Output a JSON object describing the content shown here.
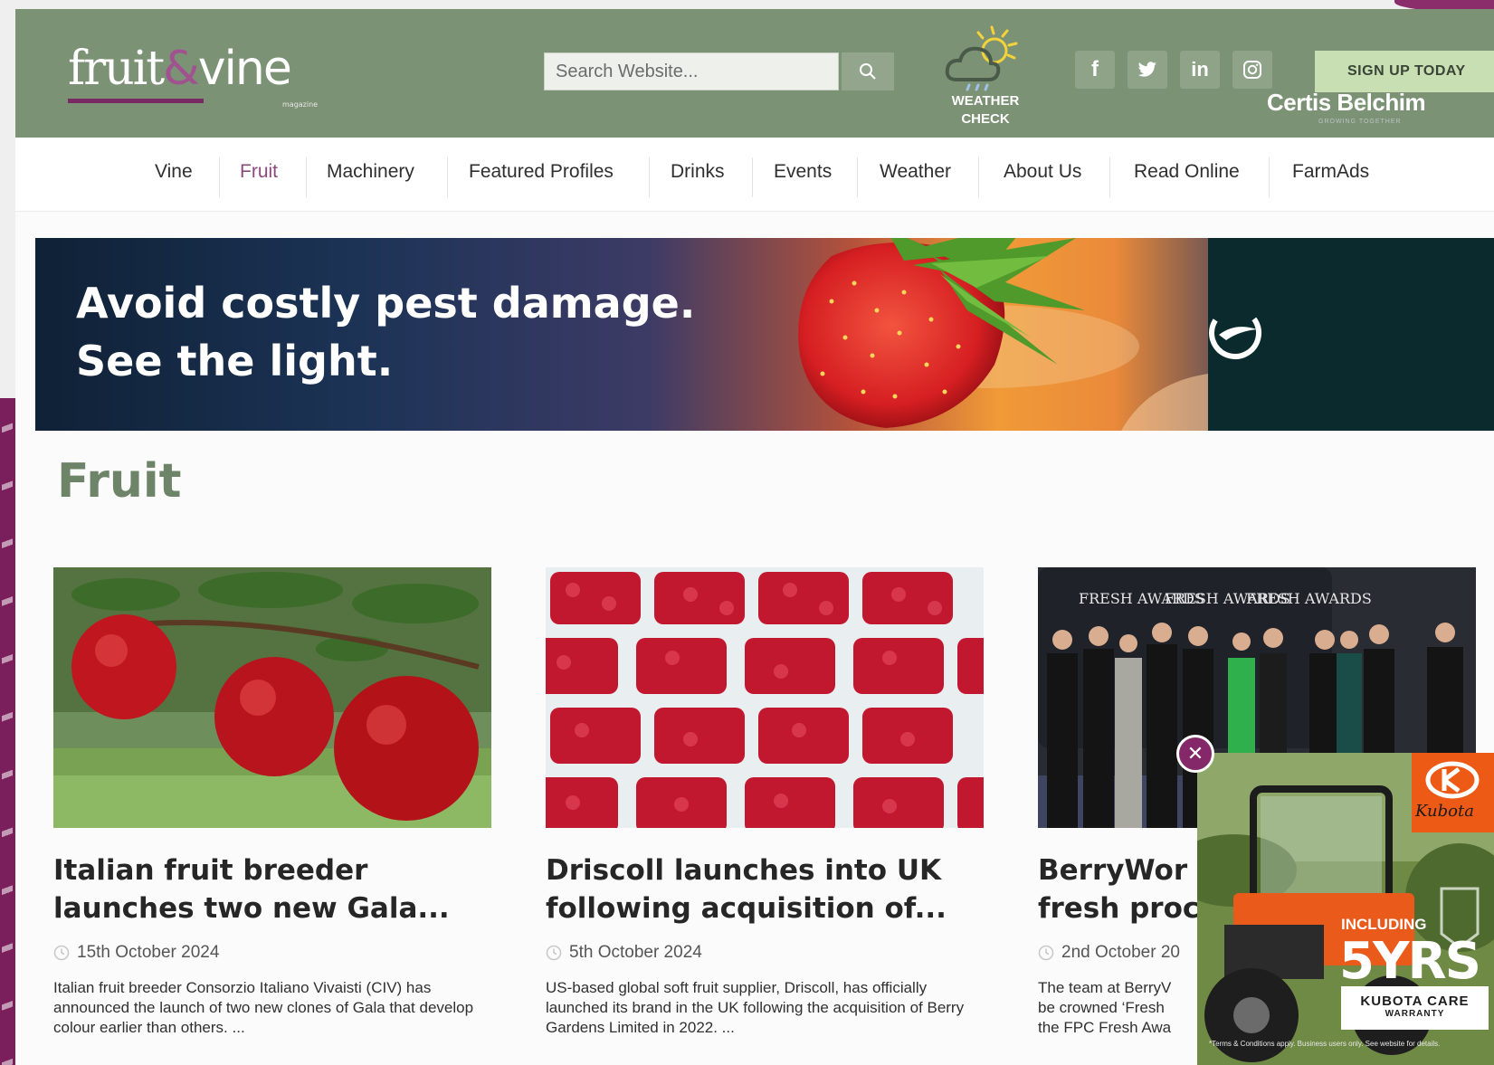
{
  "header": {
    "logo_text_1": "fruit",
    "logo_text_amp": "&",
    "logo_text_2": "vine",
    "logo_sub": "magazine",
    "search_placeholder": "Search Website...",
    "weather_label_1": "WEATHER",
    "weather_label_2": "CHECK",
    "social": [
      {
        "icon": "facebook-icon",
        "glyph": "f"
      },
      {
        "icon": "twitter-icon",
        "glyph": "🐦"
      },
      {
        "icon": "linkedin-icon",
        "glyph": "in"
      },
      {
        "icon": "instagram-icon",
        "glyph": "◎"
      }
    ],
    "signup_label": "SIGN UP TODAY"
  },
  "nav": {
    "items": [
      {
        "label": "Vine",
        "active": false
      },
      {
        "label": "Fruit",
        "active": true
      },
      {
        "label": "Machinery",
        "active": false
      },
      {
        "label": "Featured Profiles",
        "active": false
      },
      {
        "label": "Drinks",
        "active": false
      },
      {
        "label": "Events",
        "active": false
      },
      {
        "label": "Weather",
        "active": false
      },
      {
        "label": "About Us",
        "active": false
      },
      {
        "label": "Read Online",
        "active": false
      },
      {
        "label": "FarmAds",
        "active": false
      }
    ]
  },
  "banner": {
    "line1": "Avoid costly pest damage.",
    "line2": "See the light.",
    "brand": "Certis Belchim",
    "brand_sub": "GROWING TOGETHER"
  },
  "section": {
    "title": "Fruit"
  },
  "articles": [
    {
      "title_1": "Italian fruit breeder",
      "title_2": "launches two new Gala...",
      "date": "15th October 2024",
      "excerpt": "Italian fruit breeder Consorzio Italiano Vivaisti (CIV) has announced the launch of two new clones of Gala that develop colour earlier than others. ..."
    },
    {
      "title_1": "Driscoll launches into UK",
      "title_2": "following acquisition of...",
      "date": "5th October 2024",
      "excerpt": "US-based global soft fruit supplier, Driscoll, has officially launched its brand in the UK following the acquisition of Berry Gardens Limited in 2022. ..."
    },
    {
      "title_1": "BerryWor",
      "title_2": "fresh proc",
      "date": "2nd October 20",
      "excerpt_1": "The team at BerryV",
      "excerpt_2": "be crowned ‘Fresh",
      "excerpt_3": "the FPC Fresh Awa",
      "award_text": "FRESH AWARDS"
    }
  ],
  "popup_ad": {
    "close_glyph": "✕",
    "brand": "Kubota",
    "including": "INCLUDING",
    "years": "5YRS",
    "care_1": "KUBOTA CARE",
    "care_2": "WARRANTY",
    "terms": "*Terms & Conditions apply. Business users only. See website for details."
  },
  "colors": {
    "header_green": "#7c9275",
    "accent_purple": "#8b4a7c",
    "section_title": "#6e8468",
    "signup_bg": "#c8dfb3",
    "kubota_orange": "#ec5a16"
  }
}
